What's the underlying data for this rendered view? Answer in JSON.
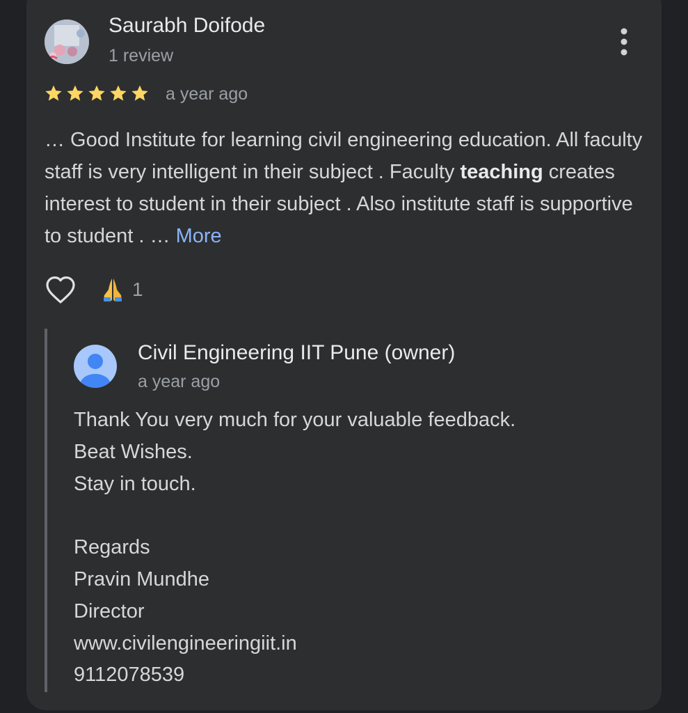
{
  "review": {
    "reviewer_name": "Saurabh Doifode",
    "review_count": "1 review",
    "rating": 5,
    "max_rating": 5,
    "timestamp": "a year ago",
    "text_start": "… Good Institute for learning civil engineering education. All faculty staff is very intelligent in their subject . Faculty ",
    "text_bold": "teaching",
    "text_end": " creates interest to student in their subject . Also institute staff is supportive to student . … ",
    "more_label": "More",
    "reaction_count": "1"
  },
  "owner_reply": {
    "name": "Civil Engineering IIT Pune (owner)",
    "timestamp": "a year ago",
    "lines": {
      "l1": "Thank You very much for your valuable feedback.",
      "l2": "Beat Wishes.",
      "l3": "Stay in touch.",
      "l4": "",
      "l5": "Regards",
      "l6": "Pravin Mundhe",
      "l7": "Director",
      "l8": "www.civilengineeringiit.in",
      "l9": "9112078539"
    }
  },
  "icons": {
    "menu": "more-vertical-icon",
    "like": "heart-outline-icon",
    "reaction": "folded-hands-emoji",
    "star": "star-icon",
    "owner_avatar": "person-icon"
  },
  "colors": {
    "background": "#202124",
    "card": "#2d2e30",
    "star": "#fdd663",
    "link": "#8ab4f8",
    "owner_avatar_bg": "#a8c7fa",
    "owner_avatar_fg": "#4285f4"
  }
}
